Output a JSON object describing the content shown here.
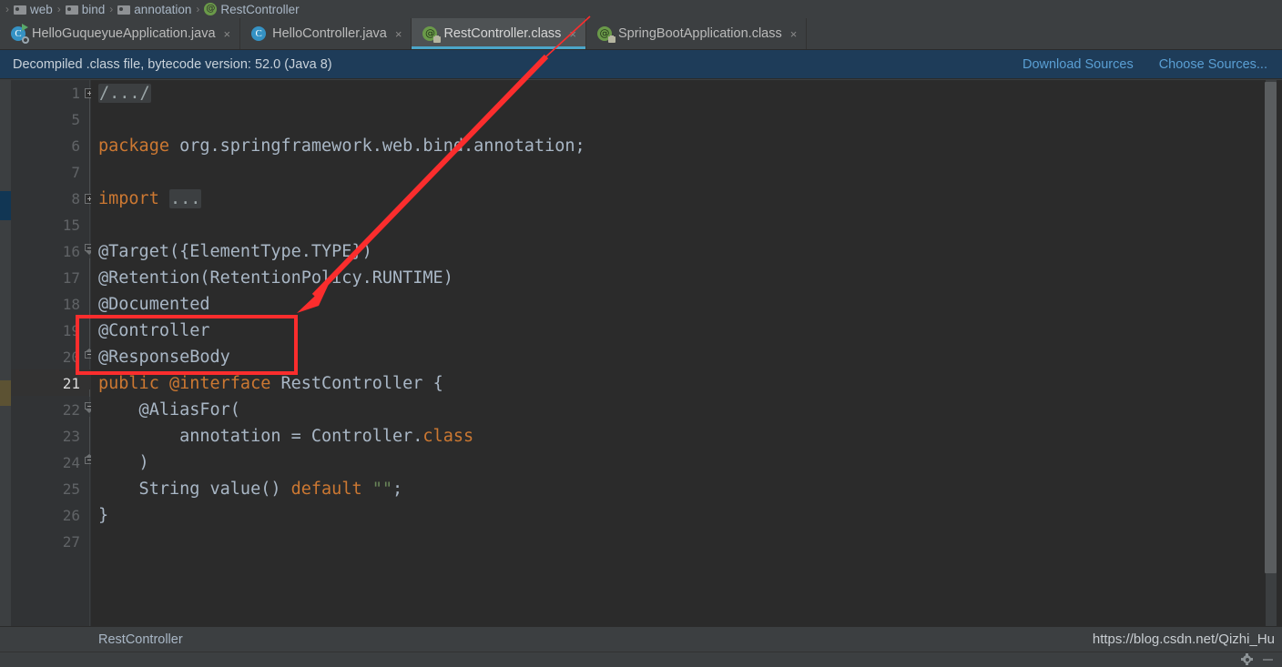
{
  "breadcrumb": {
    "items": [
      {
        "label": "web",
        "icon": "folder-icon"
      },
      {
        "label": "bind",
        "icon": "folder-icon"
      },
      {
        "label": "annotation",
        "icon": "folder-icon"
      },
      {
        "label": "RestController",
        "icon": "annotation-icon"
      }
    ],
    "separator": "›"
  },
  "tabs": [
    {
      "label": "HelloGuqueyueApplication.java",
      "icon": "java-class-run-icon",
      "active": false,
      "close": "×"
    },
    {
      "label": "HelloController.java",
      "icon": "java-class-icon",
      "active": false,
      "close": "×"
    },
    {
      "label": "RestController.class",
      "icon": "annotation-locked-icon",
      "active": true,
      "close": "×"
    },
    {
      "label": "SpringBootApplication.class",
      "icon": "annotation-locked-icon",
      "active": false,
      "close": "×"
    }
  ],
  "notification": {
    "message": "Decompiled .class file, bytecode version: 52.0 (Java 8)",
    "download_sources_label": "Download Sources",
    "choose_sources_label": "Choose Sources...",
    "background_color": "#1e3c59",
    "link_color": "#5a9fd4"
  },
  "editor": {
    "line_numbers": [
      "1",
      "5",
      "6",
      "7",
      "8",
      "15",
      "16",
      "17",
      "18",
      "19",
      "20",
      "21",
      "22",
      "23",
      "24",
      "25",
      "26",
      "27"
    ],
    "current_line": "21",
    "lines": [
      {
        "num": "1",
        "tokens": [
          {
            "t": "/.../",
            "c": "fold"
          }
        ]
      },
      {
        "num": "5",
        "tokens": []
      },
      {
        "num": "6",
        "tokens": [
          {
            "t": "package",
            "c": "kw"
          },
          {
            "t": " org.springframework.web.bind.annotation;",
            "c": "plain"
          }
        ]
      },
      {
        "num": "7",
        "tokens": []
      },
      {
        "num": "8",
        "tokens": [
          {
            "t": "import",
            "c": "kw"
          },
          {
            "t": " ",
            "c": "plain"
          },
          {
            "t": "...",
            "c": "fold"
          }
        ]
      },
      {
        "num": "15",
        "tokens": []
      },
      {
        "num": "16",
        "tokens": [
          {
            "t": "@Target({ElementType.TYPE})",
            "c": "plain"
          }
        ]
      },
      {
        "num": "17",
        "tokens": [
          {
            "t": "@Retention(RetentionPolicy.RUNTIME)",
            "c": "plain"
          }
        ]
      },
      {
        "num": "18",
        "tokens": [
          {
            "t": "@Documented",
            "c": "plain"
          }
        ]
      },
      {
        "num": "19",
        "tokens": [
          {
            "t": "@Controller",
            "c": "plain"
          }
        ]
      },
      {
        "num": "20",
        "tokens": [
          {
            "t": "@ResponseBody",
            "c": "plain"
          }
        ]
      },
      {
        "num": "21",
        "tokens": [
          {
            "t": "public @interface",
            "c": "kw"
          },
          {
            "t": " RestController {",
            "c": "plain"
          }
        ]
      },
      {
        "num": "22",
        "tokens": [
          {
            "t": "    @AliasFor(",
            "c": "plain"
          }
        ]
      },
      {
        "num": "23",
        "tokens": [
          {
            "t": "        annotation = Controller.",
            "c": "plain"
          },
          {
            "t": "class",
            "c": "kw"
          }
        ]
      },
      {
        "num": "24",
        "tokens": [
          {
            "t": "    )",
            "c": "plain"
          }
        ]
      },
      {
        "num": "25",
        "tokens": [
          {
            "t": "    String value() ",
            "c": "plain"
          },
          {
            "t": "default",
            "c": "kw"
          },
          {
            "t": " ",
            "c": "plain"
          },
          {
            "t": "\"\"",
            "c": "str"
          },
          {
            "t": ";",
            "c": "plain"
          }
        ]
      },
      {
        "num": "26",
        "tokens": [
          {
            "t": "}",
            "c": "plain"
          }
        ]
      },
      {
        "num": "27",
        "tokens": []
      }
    ],
    "colors": {
      "background": "#2b2b2b",
      "gutter": "#313335",
      "keyword": "#cc7832",
      "identifier": "#a9b7c6",
      "string": "#6a8759",
      "caret_line": "#323232"
    }
  },
  "annotations": {
    "red_rectangle": {
      "color": "#fb2d2d",
      "covers_lines": [
        "19",
        "20"
      ],
      "covers_text": "@Controller @ResponseBody"
    },
    "red_arrow": {
      "color": "#fb2d2d",
      "points_to": "@Controller"
    }
  },
  "bottom": {
    "breadcrumb_label": "RestController",
    "watermark": "https://blog.csdn.net/Qizhi_Hu"
  }
}
